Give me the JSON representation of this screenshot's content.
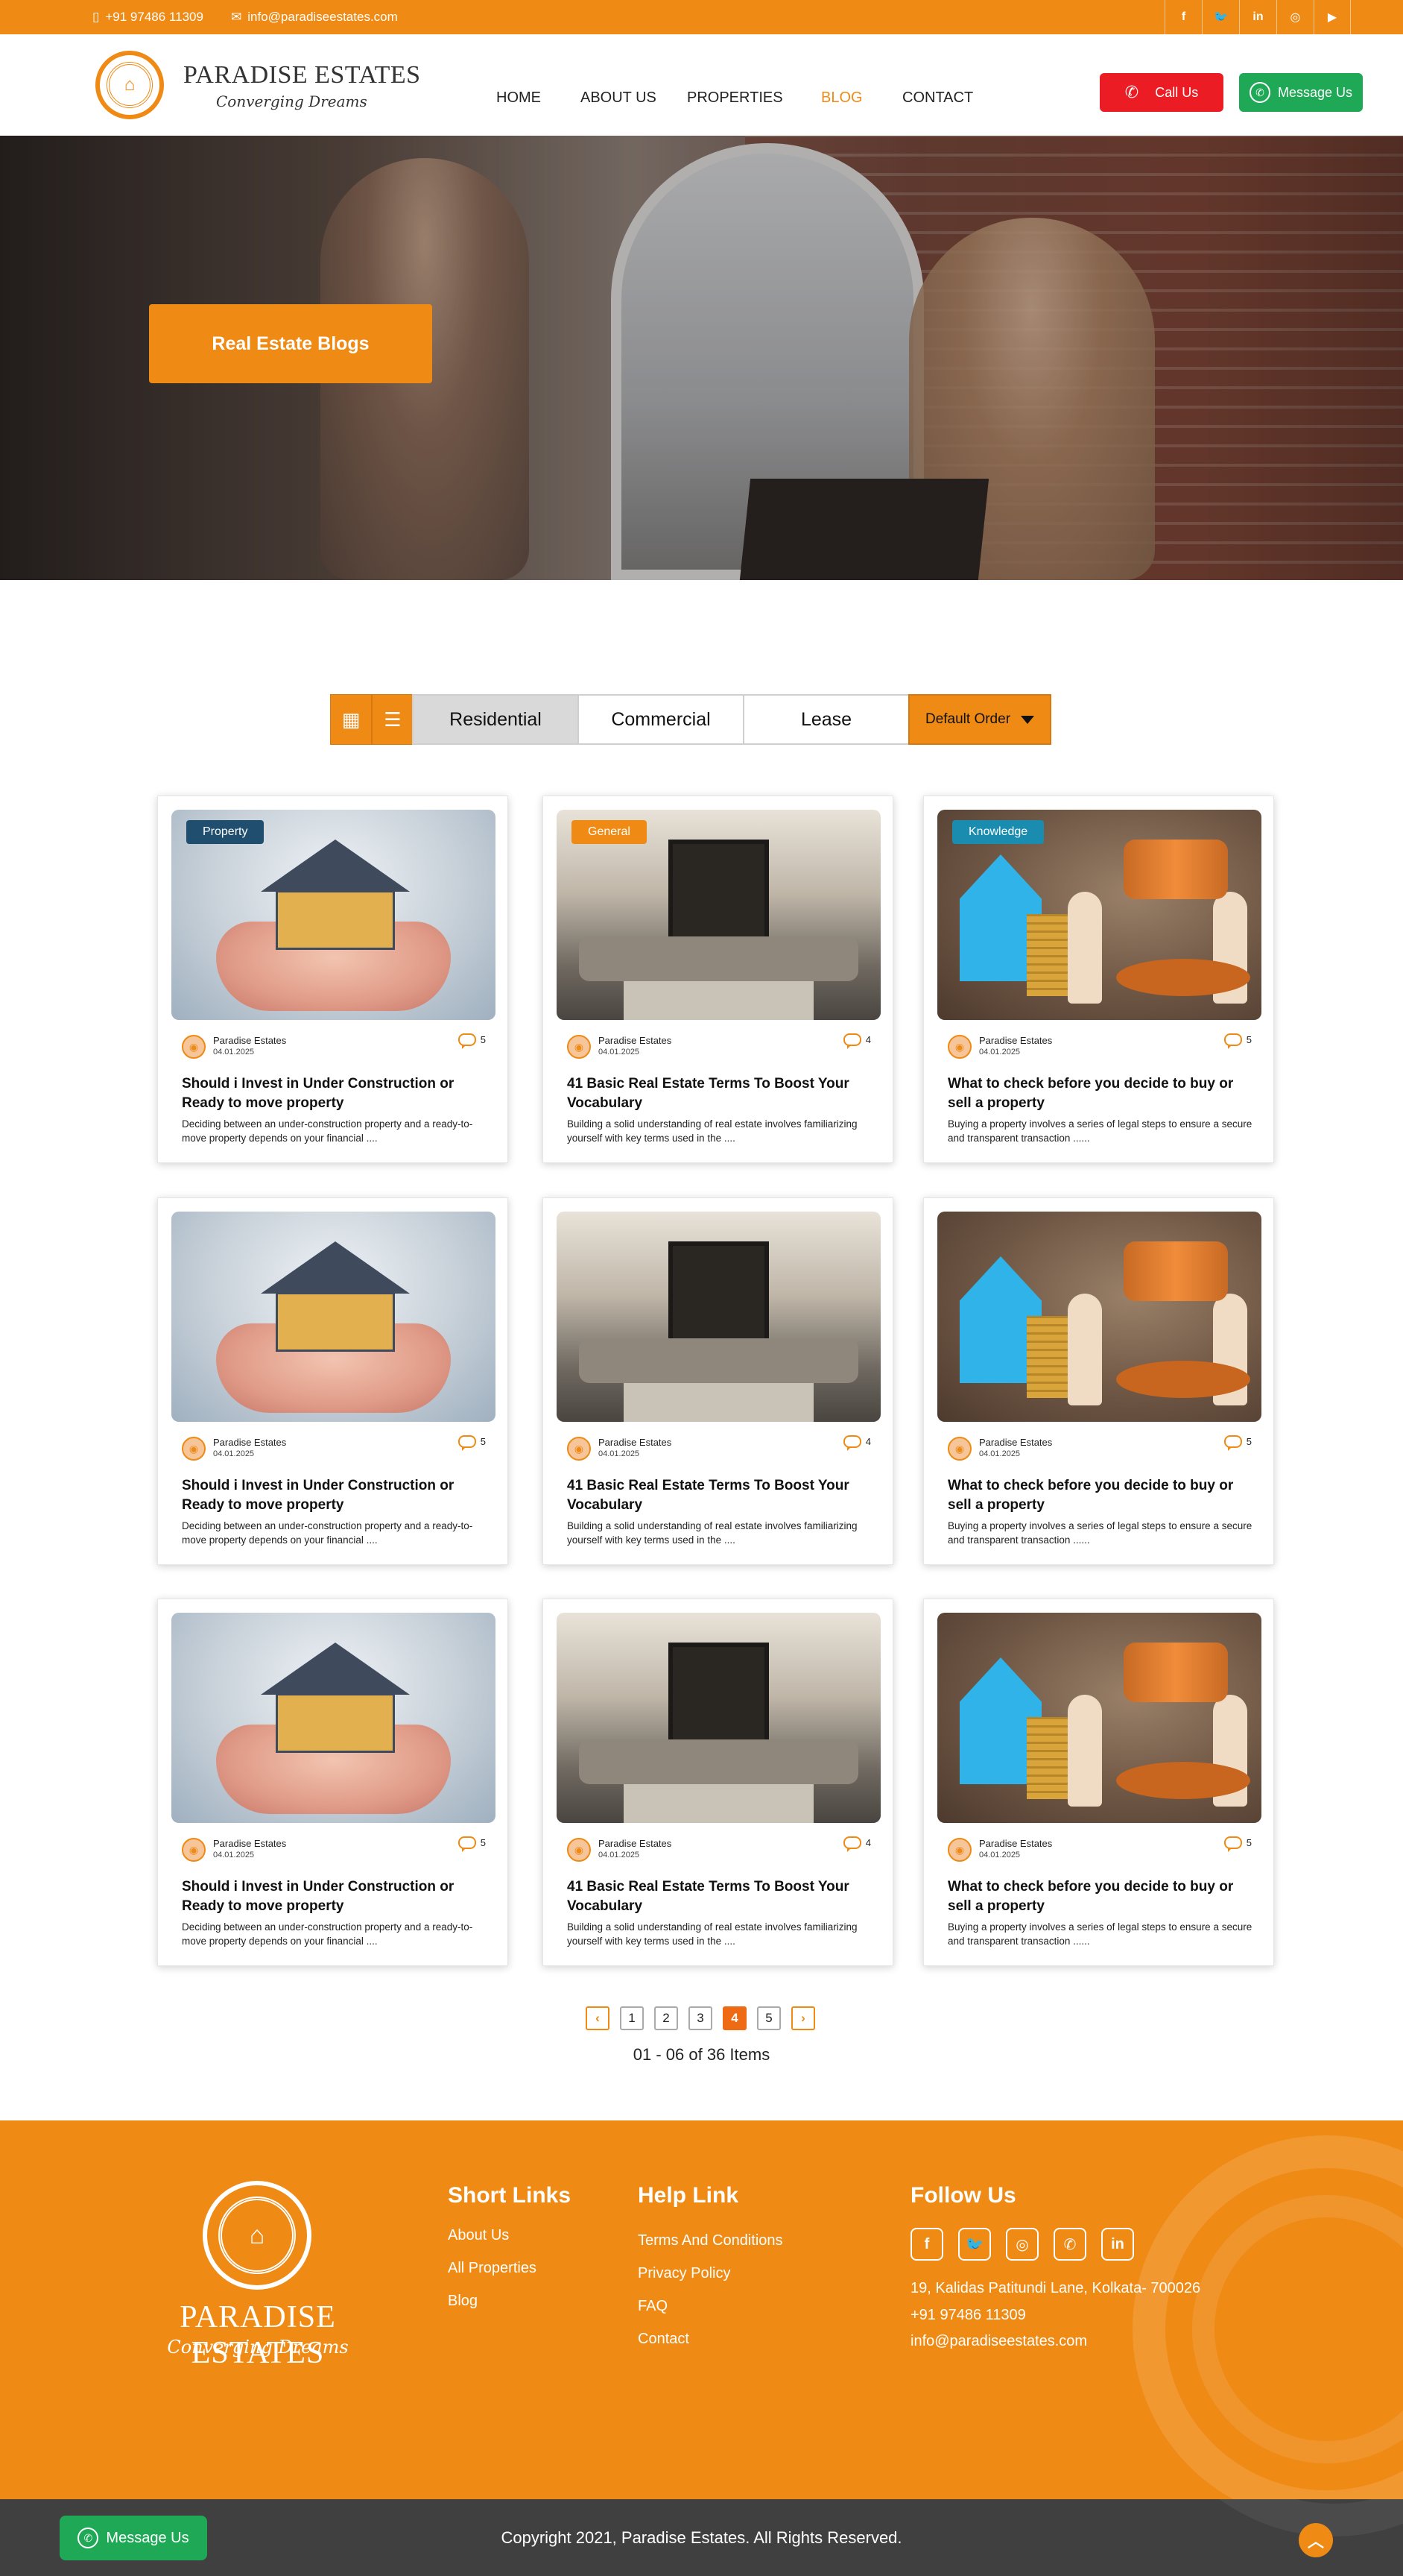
{
  "topbar": {
    "phone": "+91 97486 11309",
    "email": "info@paradiseestates.com",
    "socials": [
      {
        "icon": "facebook-icon",
        "glyph": "f"
      },
      {
        "icon": "twitter-icon",
        "glyph": "🐦"
      },
      {
        "icon": "linkedin-icon",
        "glyph": "in"
      },
      {
        "icon": "instagram-icon",
        "glyph": "◎"
      },
      {
        "icon": "youtube-icon",
        "glyph": "▶"
      }
    ]
  },
  "header": {
    "brand": "PARADISE ESTATES",
    "tagline": "Converging Dreams",
    "nav": [
      "HOME",
      "ABOUT US",
      "PROPERTIES",
      "BLOG",
      "CONTACT"
    ],
    "active_nav": "BLOG",
    "call_label": "Call Us",
    "message_label": "Message Us"
  },
  "hero": {
    "title": "Real Estate Blogs"
  },
  "filters": {
    "tabs": [
      "Residential",
      "Commercial",
      "Lease"
    ],
    "active_tab": "Residential",
    "order_label": "Default Order"
  },
  "posts": [
    {
      "category": "Property",
      "author": "Paradise Estates",
      "date": "04.01.2025",
      "comments": "5",
      "title": "Should i Invest in Under Construction or Ready to move property",
      "excerpt": "Deciding between an under-construction property and a ready-to-move property depends on your financial ....",
      "image": "house-in-hands"
    },
    {
      "category": "General",
      "author": "Paradise Estates",
      "date": "04.01.2025",
      "comments": "4",
      "title": "41 Basic Real Estate Terms To Boost Your Vocabulary",
      "excerpt": "Building a solid understanding of real estate involves familiarizing yourself with key terms used in the ....",
      "image": "living-room"
    },
    {
      "category": "Knowledge",
      "author": "Paradise Estates",
      "date": "04.01.2025",
      "comments": "5",
      "title": "What to check before you decide to buy or sell a property",
      "excerpt": "Buying a property involves a series of legal steps to ensure a secure and transparent transaction ......",
      "image": "gavel-house"
    },
    {
      "category": "",
      "author": "Paradise Estates",
      "date": "04.01.2025",
      "comments": "5",
      "title": "Should i Invest in Under Construction or Ready to move property",
      "excerpt": "Deciding between an under-construction property and a ready-to-move property depends on your financial ....",
      "image": "house-in-hands"
    },
    {
      "category": "",
      "author": "Paradise Estates",
      "date": "04.01.2025",
      "comments": "4",
      "title": "41 Basic Real Estate Terms To Boost Your Vocabulary",
      "excerpt": "Building a solid understanding of real estate involves familiarizing yourself with key terms used in the ....",
      "image": "living-room"
    },
    {
      "category": "",
      "author": "Paradise Estates",
      "date": "04.01.2025",
      "comments": "5",
      "title": "What to check before you decide to buy or sell a property",
      "excerpt": "Buying a property involves a series of legal steps to ensure a secure and transparent transaction ......",
      "image": "gavel-house"
    },
    {
      "category": "",
      "author": "Paradise Estates",
      "date": "04.01.2025",
      "comments": "5",
      "title": "Should i Invest in Under Construction or Ready to move property",
      "excerpt": "Deciding between an under-construction property and a ready-to-move property depends on your financial ....",
      "image": "house-in-hands"
    },
    {
      "category": "",
      "author": "Paradise Estates",
      "date": "04.01.2025",
      "comments": "4",
      "title": "41 Basic Real Estate Terms To Boost Your Vocabulary",
      "excerpt": "Building a solid understanding of real estate involves familiarizing yourself with key terms used in the ....",
      "image": "living-room"
    },
    {
      "category": "",
      "author": "Paradise Estates",
      "date": "04.01.2025",
      "comments": "5",
      "title": "What to check before you decide to buy or sell a property",
      "excerpt": "Buying a property involves a series of legal steps to ensure a secure and transparent transaction ......",
      "image": "gavel-house"
    }
  ],
  "pagination": {
    "prev": "‹",
    "next": "›",
    "pages": [
      "1",
      "2",
      "3",
      "4",
      "5"
    ],
    "active_page": "4",
    "summary": "01 - 06 of 36 Items"
  },
  "footer": {
    "brand": "PARADISE ESTATES",
    "tagline": "Converging Dreams",
    "short_links_title": "Short Links",
    "short_links": [
      "About Us",
      "All Properties",
      "Blog"
    ],
    "help_title": "Help Link",
    "help_links": [
      "Terms And Conditions",
      "Privacy Policy",
      "FAQ",
      "Contact"
    ],
    "follow_title": "Follow Us",
    "socials": [
      {
        "icon": "facebook-icon",
        "glyph": "f"
      },
      {
        "icon": "twitter-icon",
        "glyph": "🐦"
      },
      {
        "icon": "instagram-icon",
        "glyph": "◎"
      },
      {
        "icon": "whatsapp-icon",
        "glyph": "✆"
      },
      {
        "icon": "linkedin-icon",
        "glyph": "in"
      }
    ],
    "address": "19, Kalidas Patitundi Lane, Kolkata- 700026",
    "phone": "+91 97486 11309",
    "email": "info@paradiseestates.com"
  },
  "bottom": {
    "copyright": "Copyright 2021, Paradise Estates. All Rights Reserved.",
    "message_label": "Message Us"
  },
  "colors": {
    "accent": "#ef8a14",
    "call": "#ec1c24",
    "whatsapp": "#1fa855",
    "footer_bottom": "#404040"
  }
}
